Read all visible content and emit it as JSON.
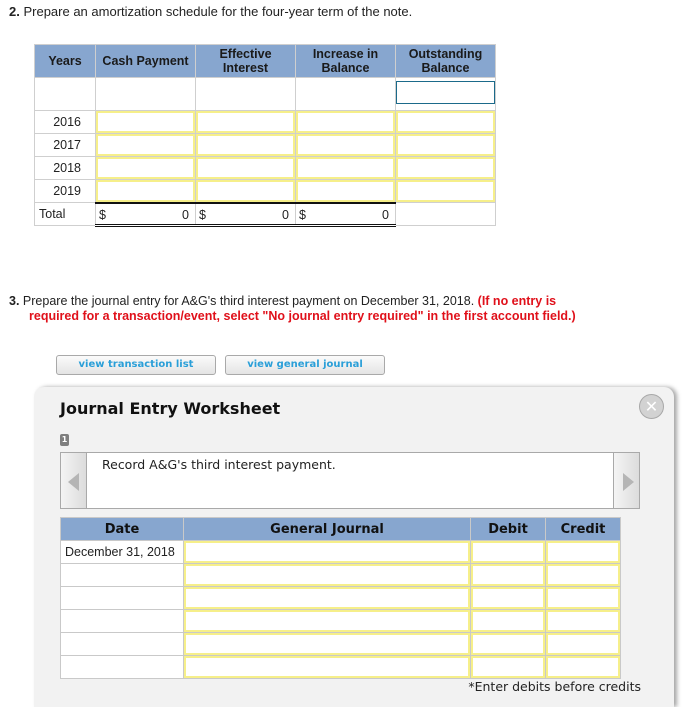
{
  "question2": {
    "number": "2.",
    "text": "Prepare an amortization schedule for the four-year term of the note."
  },
  "amortization_table": {
    "headers": [
      "Years",
      "Cash Payment",
      "Effective Interest",
      "Increase in Balance",
      "Outstanding Balance"
    ],
    "header_lines": {
      "years": "Years",
      "cash": "Cash Payment",
      "eff_1": "Effective",
      "eff_2": "Interest",
      "inc_1": "Increase in",
      "inc_2": "Balance",
      "out_1": "Outstanding",
      "out_2": "Balance"
    },
    "rows": [
      {
        "year": "",
        "cash_payment": "",
        "effective_interest": "",
        "increase_in_balance": "",
        "outstanding_balance": ""
      },
      {
        "year": "2016",
        "cash_payment": "",
        "effective_interest": "",
        "increase_in_balance": "",
        "outstanding_balance": ""
      },
      {
        "year": "2017",
        "cash_payment": "",
        "effective_interest": "",
        "increase_in_balance": "",
        "outstanding_balance": ""
      },
      {
        "year": "2018",
        "cash_payment": "",
        "effective_interest": "",
        "increase_in_balance": "",
        "outstanding_balance": ""
      },
      {
        "year": "2019",
        "cash_payment": "",
        "effective_interest": "",
        "increase_in_balance": "",
        "outstanding_balance": ""
      }
    ],
    "total": {
      "label": "Total",
      "currency": "$",
      "cash_payment": "0",
      "effective_interest": "0",
      "increase_in_balance": "0"
    }
  },
  "question3": {
    "number": "3.",
    "text": "Prepare the journal entry for A&G's third interest payment on December 31, 2018.",
    "instruction_red_1": "(If no entry is",
    "instruction_red_2": "required for a transaction/event, select \"No journal entry required\" in the first account field.)"
  },
  "buttons": {
    "view_transaction_list": "view transaction list",
    "view_general_journal": "view general journal"
  },
  "worksheet": {
    "title": "Journal Entry Worksheet",
    "close_icon": "close-icon",
    "step_number": "1",
    "transaction_text": "Record A&G's third interest payment.",
    "columns": {
      "date": "Date",
      "general_journal": "General Journal",
      "debit": "Debit",
      "credit": "Credit"
    },
    "rows": [
      {
        "date": "December 31, 2018",
        "account": "",
        "debit": "",
        "credit": ""
      },
      {
        "date": "",
        "account": "",
        "debit": "",
        "credit": ""
      },
      {
        "date": "",
        "account": "",
        "debit": "",
        "credit": ""
      },
      {
        "date": "",
        "account": "",
        "debit": "",
        "credit": ""
      },
      {
        "date": "",
        "account": "",
        "debit": "",
        "credit": ""
      },
      {
        "date": "",
        "account": "",
        "debit": "",
        "credit": ""
      }
    ],
    "footnote": "*Enter debits before credits"
  },
  "colors": {
    "header_blue": "#87a6cf",
    "input_border_yellow": "#f6ef8a",
    "focus_border": "#1b6a8a",
    "instruction_red": "#e0101a",
    "button_text_blue": "#2a9fd8"
  }
}
